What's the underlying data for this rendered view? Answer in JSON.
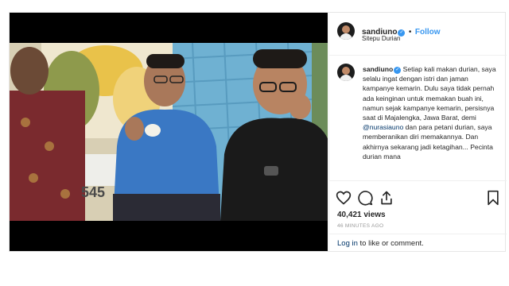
{
  "header": {
    "username": "sandiuno",
    "separator": "•",
    "follow_label": "Follow",
    "location": "Sitepu Durian"
  },
  "caption": {
    "username": "sandiuno",
    "text_before_mention": "Setiap kali makan durian, saya selalu ingat dengan istri dan jaman kampanye kemarin. Dulu saya tidak pernah ada keinginan untuk memakan buah ini, namun sejak kampanye kemarin, persisnya saat di Majalengka, Jawa Barat, demi",
    "mention": "@nurasiauno",
    "text_after_mention": "dan para petani durian, saya memberanikan diri memakannya. Dan akhirnya sekarang jadi ketagihan... Pecinta durian mana"
  },
  "video": {
    "sign_text": "545"
  },
  "stats": {
    "views": "40,421 views",
    "time": "46 MINUTES AGO"
  },
  "login": {
    "link": "Log in",
    "rest": " to like or comment."
  },
  "icons": [
    "heart-icon",
    "comment-icon",
    "share-icon",
    "bookmark-icon",
    "verified-badge-icon"
  ]
}
